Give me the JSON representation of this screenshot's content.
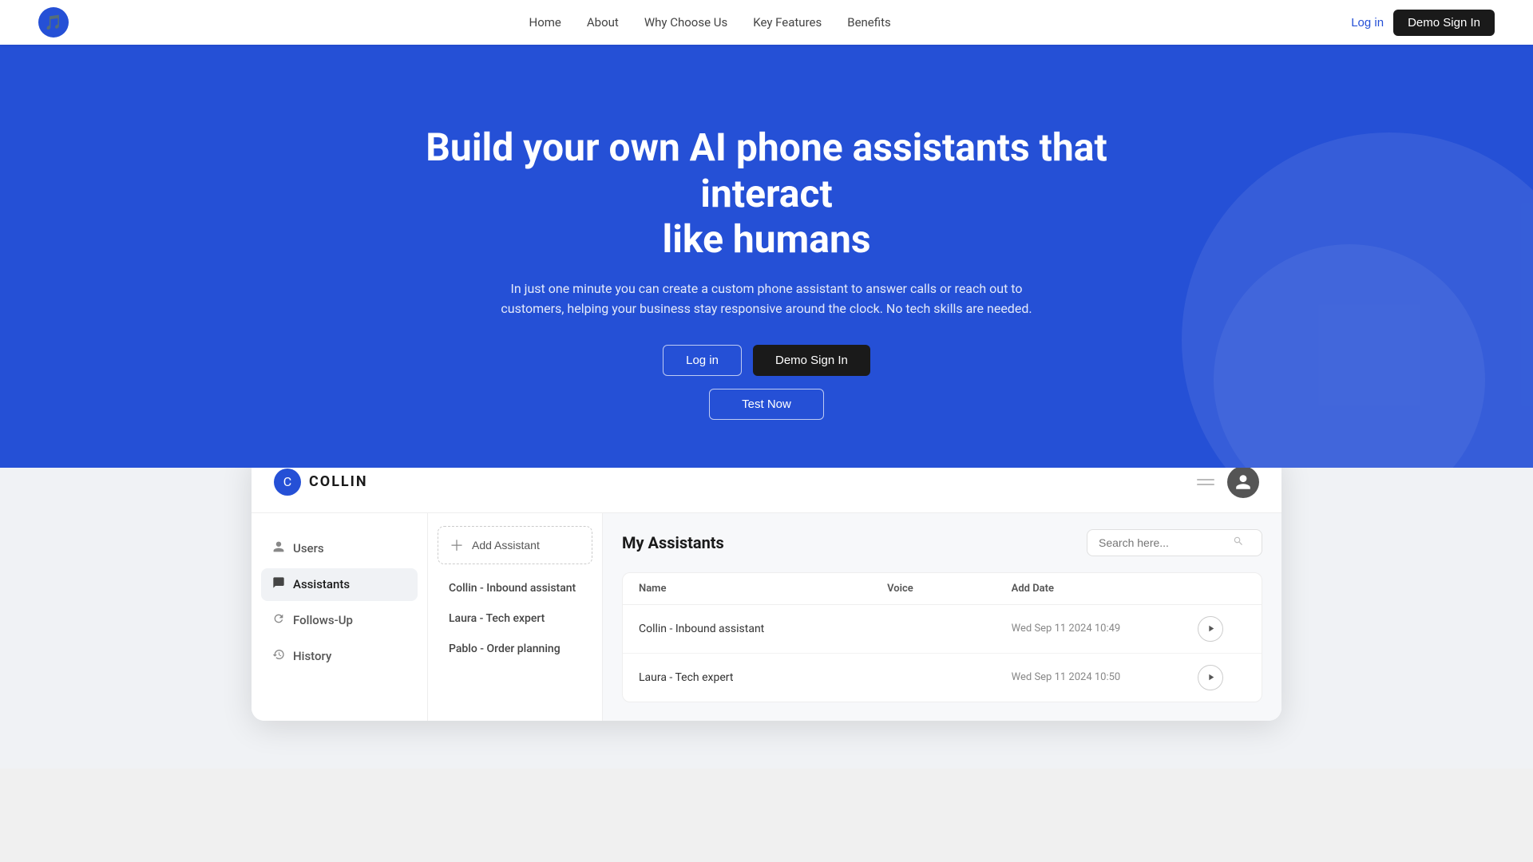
{
  "nav": {
    "logo_icon": "🎵",
    "links": [
      "Home",
      "About",
      "Why Choose Us",
      "Key Features",
      "Benefits"
    ],
    "login_label": "Log in",
    "demo_label": "Demo Sign In"
  },
  "hero": {
    "headline_line1": "Build your own AI phone assistants that interact",
    "headline_line2": "like humans",
    "description": "In just one minute you can create a custom phone assistant to answer calls or reach out to customers, helping your business stay responsive around the clock. No tech skills are needed.",
    "btn_login": "Log in",
    "btn_demo": "Demo Sign In",
    "btn_test": "Test Now"
  },
  "app": {
    "logo_text": "COLLIN",
    "logo_icon": "C",
    "sidebar": {
      "items": [
        {
          "label": "Users",
          "icon": "👤"
        },
        {
          "label": "Assistants",
          "icon": "🤖",
          "active": true
        },
        {
          "label": "Follows-Up",
          "icon": "🔄"
        },
        {
          "label": "History",
          "icon": "📋"
        }
      ]
    },
    "assistant_list": {
      "add_label": "Add Assistant",
      "items": [
        {
          "label": "Collin - Inbound assistant"
        },
        {
          "label": "Laura - Tech expert"
        },
        {
          "label": "Pablo - Order planning"
        }
      ]
    },
    "main": {
      "title": "My Assistants",
      "search_placeholder": "Search here...",
      "table": {
        "columns": [
          "Name",
          "Voice",
          "Add Date"
        ],
        "rows": [
          {
            "name": "Collin - Inbound assistant",
            "voice": "",
            "date": "Wed Sep 11 2024  10:49"
          },
          {
            "name": "Laura - Tech expert",
            "voice": "",
            "date": "Wed Sep 11 2024  10:50"
          }
        ]
      }
    }
  }
}
